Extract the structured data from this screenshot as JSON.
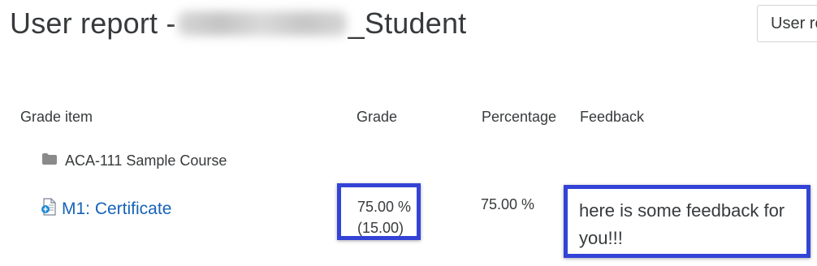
{
  "page": {
    "title_prefix": "User report -",
    "title_suffix": "_Student",
    "report_button_label": "User re"
  },
  "table": {
    "headers": {
      "grade_item": "Grade item",
      "grade": "Grade",
      "percentage": "Percentage",
      "feedback": "Feedback"
    },
    "course": {
      "name": "ACA-111 Sample Course",
      "icon": "folder-icon"
    },
    "item": {
      "name": "M1: Certificate",
      "icon": "certificate-icon",
      "grade_percent": "75.00 %",
      "grade_points": "(15.00)",
      "percentage": "75.00 %",
      "feedback": "here is some feedback for you!!!"
    }
  },
  "colors": {
    "link": "#1763b8",
    "highlight_border": "#3343d6",
    "text": "#373a3c"
  }
}
